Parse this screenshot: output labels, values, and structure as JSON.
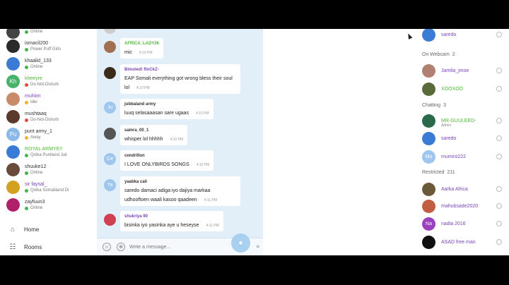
{
  "colors": {
    "accent": "#3b8fd9",
    "chat_bg": "#e2eef8",
    "online": "#44b44c",
    "dnd": "#e24b3b",
    "idle": "#f0b429",
    "username_purple": "#7a44b8",
    "username_green": "#4fb834"
  },
  "sidebar": {
    "contacts": [
      {
        "name": "",
        "status": "Online",
        "status_color": "#44b44c",
        "avatar_color": "#444444",
        "avatar_text": ""
      },
      {
        "name": "ismacil200",
        "status": "Power Puff Girls",
        "status_color": "#44b44c",
        "avatar_color": "#2a2a2a",
        "avatar_text": ""
      },
      {
        "name": "khaalid_133",
        "status": "Online",
        "status_color": "#44b44c",
        "avatar_color": "#3a7bd5",
        "avatar_text": ""
      },
      {
        "name": "kheeyre",
        "status": "Do-Not-Disturb",
        "status_color": "#e24b3b",
        "avatar_color": "#47b36a",
        "avatar_text": "Kh",
        "name_color": "#4fb834"
      },
      {
        "name": "muhiim",
        "status": "Idle",
        "status_color": "#f0b429",
        "avatar_color": "#c98a6a",
        "avatar_text": "",
        "name_color": "#7a44b8"
      },
      {
        "name": "mushtaaq",
        "status": "Do-Not-Disturb",
        "status_color": "#e24b3b",
        "avatar_color": "#5a3a2a",
        "avatar_text": ""
      },
      {
        "name": "punt army_1",
        "status": "Away",
        "status_color": "#f0b429",
        "avatar_color": "#8ab8e8",
        "avatar_text": "Pu"
      },
      {
        "name": "ROYAL ARMYE!!",
        "status": "Qolka Puntland Juli",
        "status_color": "#44b44c",
        "avatar_color": "#3a7bd5",
        "avatar_text": "",
        "name_color": "#4fb834"
      },
      {
        "name": "shuuke12",
        "status": "Online",
        "status_color": "#44b44c",
        "avatar_color": "#6a4a3a",
        "avatar_text": ""
      },
      {
        "name": "sir faysal_",
        "status": "Qolka Somaliland Di",
        "status_color": "#44b44c",
        "avatar_color": "#d4a020",
        "avatar_text": "",
        "name_color": "#7a44b8"
      },
      {
        "name": "zayfuun3",
        "status": "Online",
        "status_color": "#44b44c",
        "avatar_color": "#b0206a",
        "avatar_text": ""
      }
    ],
    "nav": [
      {
        "label": "Home",
        "icon": "home-icon",
        "glyph": "⌂"
      },
      {
        "label": "Rooms",
        "icon": "rooms-icon",
        "glyph": "☷"
      }
    ]
  },
  "chat": {
    "messages": [
      {
        "user": "",
        "text": "",
        "time": "",
        "avatar_color": "#cccccc"
      },
      {
        "user": "AFRICA_LADY26",
        "text": "mic",
        "time": "4:10 PM",
        "user_color": "#4fb834",
        "avatar_color": "#a07050"
      },
      {
        "user": "Bimoled! RoCkZ-",
        "text": "EAP Somali everything got wrong bless their soul lol",
        "time": "4:10 PM",
        "user_color": "#7a44b8",
        "avatar_color": "#3a2a1a"
      },
      {
        "user": "jubbaland army",
        "text": "luuq selasaaasan sare ugaas",
        "time": "4:10 PM",
        "avatar_color": "#9ec6ee",
        "avatar_text": "Ju"
      },
      {
        "user": "samra_00_1",
        "text": "whisper lol hhhhh",
        "time": "4:10 PM",
        "avatar_color": "#555555"
      },
      {
        "user": "cendrillon",
        "text": "I LOVE ONLYBIRDS SONGS",
        "time": "4:10 PM",
        "avatar_color": "#9ec6ee",
        "avatar_text": "Ce"
      },
      {
        "user": "yaabka cali",
        "text": "saredo damaci adiga iyo dajiya markaa udhooftoen waali kasoo qaadeen",
        "time": "4:11 PM",
        "avatar_color": "#9ec6ee",
        "avatar_text": "Ya"
      },
      {
        "user": "shukriya 90",
        "text": "bisinka iyo yasinka aye u heseyse",
        "time": "4:11 PM",
        "user_color": "#7a44b8",
        "avatar_color": "#d04050"
      }
    ],
    "composer": {
      "placeholder": "Write a message..."
    }
  },
  "userlist": {
    "top_user": {
      "name": "saredo"
    },
    "sections": [
      {
        "title": "On Webcam",
        "count": "2"
      },
      {
        "title": "Chatting",
        "count": "3"
      },
      {
        "title": "Restricted",
        "count": "211"
      }
    ],
    "webcam_users": [
      {
        "name": "Jamila_jmoe",
        "avatar_color": "#b08070"
      },
      {
        "name": "XOOXOO",
        "avatar_color": "#5a6a3a",
        "name_color": "#4fb834"
      }
    ],
    "chatting_users": [
      {
        "name": "MR-GUULEED-",
        "sub": "Admin",
        "avatar_color": "#2a6a4a",
        "name_color": "#4fb834"
      },
      {
        "name": "saredo",
        "avatar_color": "#3a7bd5"
      },
      {
        "name": "mumiro222",
        "avatar_color": "#9ec6ee",
        "avatar_text": "Mu"
      }
    ],
    "restricted_users": [
      {
        "name": "Aarka Africa",
        "avatar_color": "#6a5a3a"
      },
      {
        "name": "mahubsade2020",
        "avatar_color": "#c06040"
      },
      {
        "name": "nadia 2016",
        "avatar_color": "#9a40c0",
        "avatar_text": "Na"
      },
      {
        "name": "ASAD free man",
        "avatar_color": "#111111"
      }
    ]
  }
}
